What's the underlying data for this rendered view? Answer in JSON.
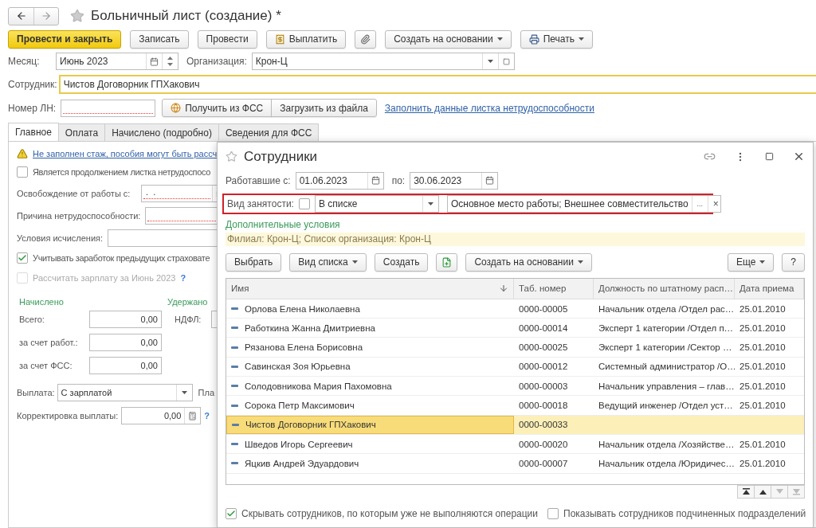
{
  "window": {
    "title": "Больничный лист (создание) *"
  },
  "toolbar": [
    {
      "kind": "primary",
      "label": "Провести и закрыть"
    },
    {
      "kind": "plain",
      "label": "Записать"
    },
    {
      "kind": "plain",
      "label": "Провести"
    },
    {
      "kind": "pay",
      "label": "Выплатить"
    },
    {
      "kind": "attach"
    },
    {
      "kind": "menu",
      "label": "Создать на основании"
    },
    {
      "kind": "print",
      "label": "Печать"
    }
  ],
  "month": {
    "label": "Месяц:",
    "value": "Июнь 2023"
  },
  "organization": {
    "label": "Организация:",
    "value": "Крон-Ц"
  },
  "employee": {
    "label": "Сотрудник:",
    "value": "Чистов Договорник ГПХакович"
  },
  "sick_note": {
    "label": "Номер ЛН:",
    "required": true,
    "buttons": [
      "Получить из ФСС",
      "Загрузить из файла"
    ],
    "link": "Заполнить данные листка нетрудоспособности"
  },
  "tabs": [
    {
      "label": "Главное",
      "selected": true
    },
    {
      "label": "Оплата",
      "selected": false
    },
    {
      "label": "Начислено (подробно)",
      "selected": false
    },
    {
      "label": "Сведения для ФСС",
      "selected": false
    }
  ],
  "main": {
    "warning": "Не заполнен стаж, пособия могут быть рассч",
    "continuation": {
      "label": "Является продолжением листка нетрудоспосо",
      "checked": false,
      "disabled": false
    },
    "release_from": {
      "label": "Освобождение от работы с:",
      "value": " .  . ",
      "required": true
    },
    "reason": {
      "label": "Причина нетрудоспособности:",
      "required": true
    },
    "conditions": {
      "label": "Условия исчисления:",
      "required": false
    },
    "prev_earnings": {
      "label": "Учитывать заработок предыдущих страховате",
      "checked": true,
      "disabled": false
    },
    "recalc": {
      "label": "Рассчитать зарплату за Июнь 2023",
      "checked": false,
      "disabled": true,
      "help": "?"
    },
    "accrued": {
      "heading": "Начислено",
      "rows": [
        {
          "label": "Всего:",
          "value": "0,00"
        },
        {
          "label": "за счет работ.:",
          "value": "0,00"
        },
        {
          "label": "за счет ФСС:",
          "value": "0,00"
        }
      ]
    },
    "withheld": {
      "heading": "Удержано",
      "rows": [
        {
          "label": "НДФЛ:"
        }
      ]
    },
    "payment": {
      "label": "Выплата:",
      "value": "С зарплатой",
      "next_label": "Пла"
    },
    "correction": {
      "label": "Корректировка выплаты:",
      "value": "0,00",
      "help": "?"
    }
  },
  "dialog": {
    "title": "Сотрудники",
    "period": {
      "from_label": "Работавшие с:",
      "from": "01.06.2023",
      "to_label": "по:",
      "to": "30.06.2023"
    },
    "employment": {
      "label": "Вид занятости:",
      "checked": false,
      "condition": "В списке",
      "value": "Основное место работы; Внешнее совместительство",
      "buttons": [
        "...",
        "×"
      ]
    },
    "extra_link": "Дополнительные условия",
    "filter_info": "Филиал: Крон-Ц; Список организация: Крон-Ц",
    "toolbar": [
      {
        "kind": "plain",
        "label": "Выбрать"
      },
      {
        "kind": "menu",
        "label": "Вид списка"
      },
      {
        "kind": "plain",
        "label": "Создать"
      },
      {
        "kind": "copy"
      },
      {
        "kind": "menu",
        "label": "Создать на основании"
      },
      {
        "kind": "spacer"
      },
      {
        "kind": "menu",
        "label": "Еще"
      },
      {
        "kind": "plain",
        "label": "?"
      }
    ],
    "columns": [
      {
        "label": "Имя",
        "sorted": true
      },
      {
        "label": "Таб. номер"
      },
      {
        "label": "Должность по штатному расп…"
      },
      {
        "label": "Дата приема"
      }
    ],
    "rows": [
      {
        "name": "Орлова Елена Николаевна",
        "number": "0000-00005",
        "position": "Начальник отдела /Отдел рас…",
        "date": "25.01.2010",
        "selected": false
      },
      {
        "name": "Работкина Жанна Дмитриевна",
        "number": "0000-00014",
        "position": "Эксперт 1 категории /Отдел п…",
        "date": "25.01.2010",
        "selected": false
      },
      {
        "name": "Рязанова Елена Борисовна",
        "number": "0000-00025",
        "position": "Эксперт 1 категории /Сектор …",
        "date": "25.01.2010",
        "selected": false
      },
      {
        "name": "Савинская Зоя Юрьевна",
        "number": "0000-00012",
        "position": "Системный администратор /О…",
        "date": "25.01.2010",
        "selected": false
      },
      {
        "name": "Солодовникова Мария Пахомовна",
        "number": "0000-00003",
        "position": "Начальник управления – глав…",
        "date": "25.01.2010",
        "selected": false
      },
      {
        "name": "Сорока Петр Максимович",
        "number": "0000-00018",
        "position": "Ведущий инженер /Отдел уст…",
        "date": "25.01.2010",
        "selected": false
      },
      {
        "name": "Чистов Договорник ГПХакович",
        "number": "0000-00033",
        "selected": true
      },
      {
        "name": "Шведов Игорь Сергеевич",
        "number": "0000-00020",
        "position": "Начальник отдела /Хозяйстве…",
        "date": "25.01.2010",
        "selected": false
      },
      {
        "name": "Яцкив Андрей Эдуардович",
        "number": "0000-00007",
        "position": "Начальник отдела /Юридичес…",
        "date": "25.01.2010",
        "selected": false
      }
    ],
    "footer": [
      {
        "label": "Скрывать сотрудников, по которым уже не выполняются операции",
        "checked": true
      },
      {
        "label": "Показывать сотрудников подчиненных подразделений",
        "checked": false
      }
    ]
  }
}
